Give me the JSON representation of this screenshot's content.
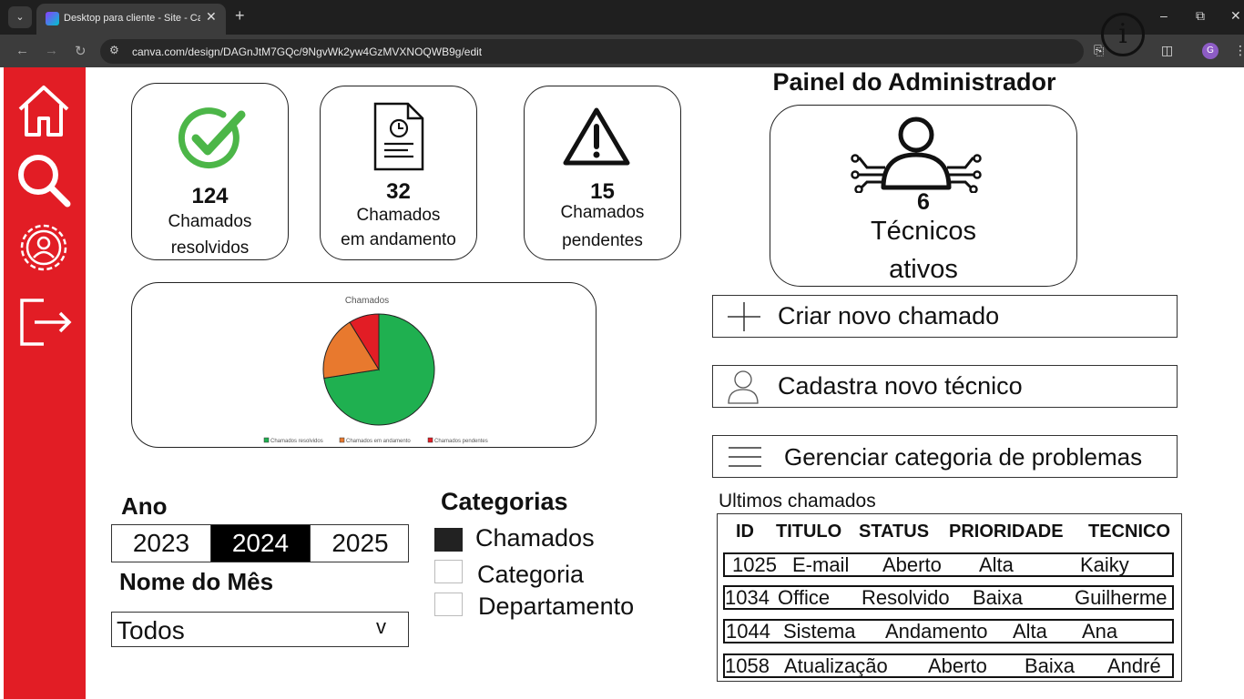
{
  "browser": {
    "tab_title": "Desktop para cliente - Site - Ca",
    "url": "canva.com/design/DAGnJtM7GQc/9NgvWk2yw4GzMVXNOQWB9g/edit",
    "profile_initial": "G"
  },
  "cards": {
    "resolved": {
      "count": "124",
      "label1": "Chamados",
      "label2": "resolvidos"
    },
    "in_progress": {
      "count": "32",
      "label1": "Chamados",
      "label2": "em andamento"
    },
    "pending": {
      "count": "15",
      "label1": "Chamados",
      "label2": "pendentes"
    }
  },
  "admin": {
    "title": "Painel do Administrador",
    "tech_count": "6",
    "tech_label1": "Técnicos",
    "tech_label2": "ativos"
  },
  "chart_data": {
    "type": "pie",
    "title": "Chamados",
    "categories": [
      "Chamados resolvidos",
      "Chamados em andamento",
      "Chamados pendentes"
    ],
    "values": [
      124,
      32,
      15
    ],
    "colors": [
      "#1fb050",
      "#e8792e",
      "#e21d25"
    ],
    "legend": "bottom"
  },
  "actions": {
    "create": "Criar novo chamado",
    "register": "Cadastra novo técnico",
    "manage": "Gerenciar categoria de problemas"
  },
  "filters": {
    "year_heading": "Ano",
    "years": [
      "2023",
      "2024",
      "2025"
    ],
    "selected_year": "2024",
    "month_heading": "Nome do Mês",
    "month_value": "Todos",
    "month_arrow": "v",
    "categories_heading": "Categorias",
    "categories": [
      {
        "label": "Chamados",
        "checked": true
      },
      {
        "label": "Categoria",
        "checked": false
      },
      {
        "label": "Departamento",
        "checked": false
      }
    ]
  },
  "table": {
    "title": "Ultimos chamados",
    "headers": [
      "ID",
      "TITULO",
      "STATUS",
      "PRIORIDADE",
      "TECNICO"
    ],
    "rows": [
      [
        "1025",
        "E-mail",
        "Aberto",
        "Alta",
        "Kaiky"
      ],
      [
        "1034",
        "Office",
        "Resolvido",
        "Baixa",
        "Guilherme"
      ],
      [
        "1044",
        "Sistema",
        "Andamento",
        "Alta",
        "Ana"
      ],
      [
        "1058",
        "Atualização",
        "Aberto",
        "Baixa",
        "André"
      ]
    ]
  }
}
